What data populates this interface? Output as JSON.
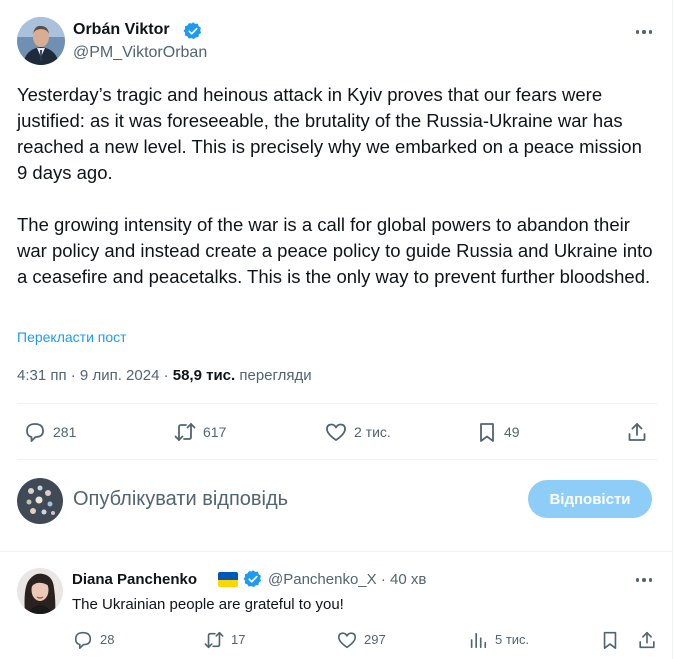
{
  "tweet": {
    "author_name": "Orbán Viktor",
    "author_handle": "@PM_ViktorOrban",
    "paragraphs": [
      "Yesterday’s tragic and heinous attack in Kyiv proves that our fears were justified: as it was foreseeable, the brutality of the Russia-Ukraine war has reached a new level. This is precisely why we embarked on a peace mission 9 days ago.",
      "The growing intensity of the war is a call for global powers to abandon their war policy and instead create a peace policy to guide Russia and Ukraine into a ceasefire and peacetalks. This is the only way to prevent further bloodshed."
    ],
    "translate_label": "Перекласти пост",
    "timestamp": "4:31 пп · 9 лип. 2024",
    "separator": "·",
    "views_count": "58,9 тис.",
    "views_label": "перегляди",
    "actions": {
      "replies": "281",
      "reposts": "617",
      "likes": "2 тис.",
      "bookmarks": "49"
    }
  },
  "composer": {
    "placeholder": "Опублікувати відповідь",
    "button_label": "Відповісти"
  },
  "reply": {
    "author_name": "Diana Panchenko",
    "author_handle": "@Panchenko_X",
    "time_ago": "· 40 хв",
    "text": "The Ukrainian people are grateful to you!",
    "actions": {
      "replies": "28",
      "reposts": "17",
      "likes": "297",
      "views": "5 тис."
    }
  },
  "colors": {
    "accent": "#1d9bf0",
    "secondary_text": "#536471",
    "reply_button_disabled": "#8ecdf8",
    "verified_badge": "#1d9bf0"
  },
  "icons": [
    "verified-badge-icon",
    "more-icon",
    "reply-icon",
    "repost-icon",
    "like-icon",
    "bookmark-icon",
    "share-icon",
    "views-icon",
    "ukraine-flag-icon"
  ]
}
